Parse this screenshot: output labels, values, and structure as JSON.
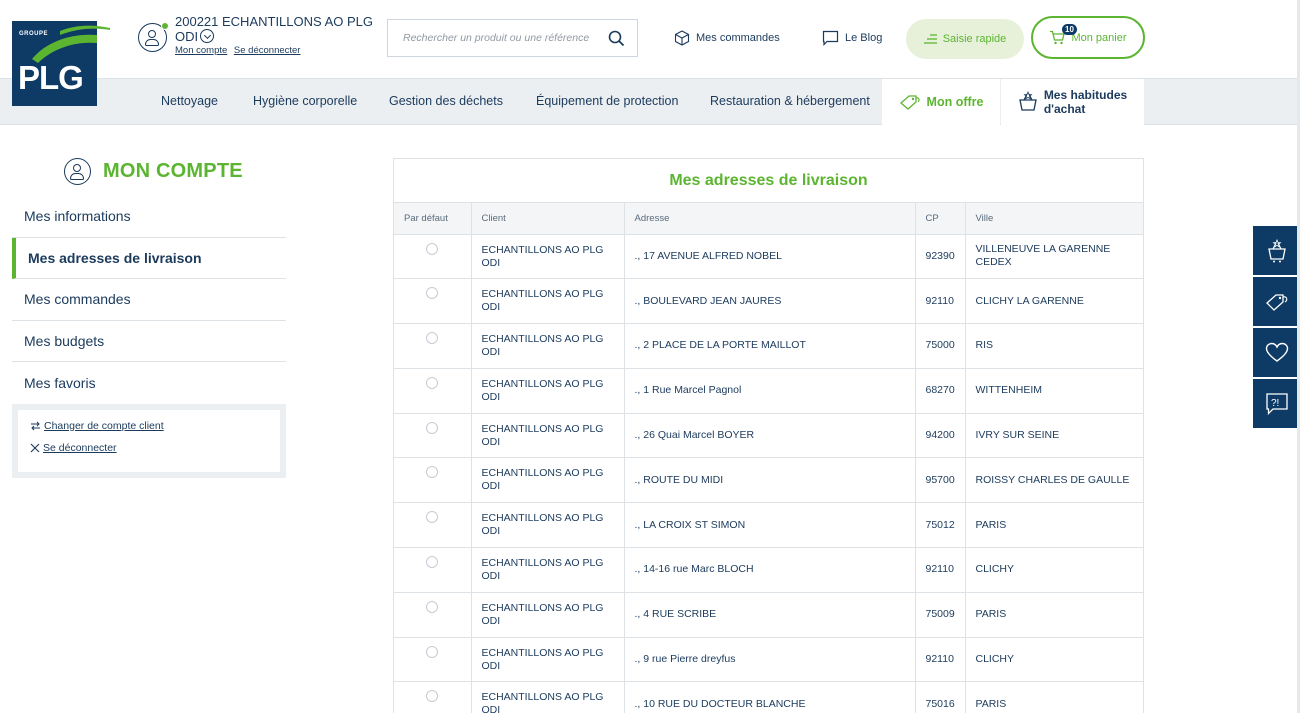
{
  "header": {
    "logo": {
      "group": "GROUPE",
      "brand": "PLG"
    },
    "account": {
      "name_line1": "200221 ECHANTILLONS AO PLG",
      "name_line2": "ODI",
      "my_account": "Mon compte",
      "logout": "Se déconnecter"
    },
    "search": {
      "placeholder": "Rechercher un produit ou une référence"
    },
    "orders_label": "Mes commandes",
    "blog_label": "Le Blog",
    "quick_entry_label": "Saisie rapide",
    "cart": {
      "label": "Mon panier",
      "count": "10"
    }
  },
  "nav": {
    "items": [
      "Nettoyage",
      "Hygiène corporelle",
      "Gestion des déchets",
      "Équipement de protection",
      "Restauration & hébergement"
    ],
    "offer": "Mon offre",
    "habits_line1": "Mes habitudes",
    "habits_line2": "d'achat"
  },
  "sidebar": {
    "title": "MON COMPTE",
    "items": [
      "Mes informations",
      "Mes adresses de livraison",
      "Mes commandes",
      "Mes budgets",
      "Mes favoris"
    ],
    "active_index": 1,
    "change_account": "Changer de compte client",
    "logout": "Se déconnecter"
  },
  "addresses": {
    "title": "Mes adresses de livraison",
    "columns": [
      "Par défaut",
      "Client",
      "Adresse",
      "CP",
      "Ville"
    ],
    "rows": [
      {
        "client": "ECHANTILLONS AO PLG ODI",
        "address": "., 17 AVENUE ALFRED NOBEL",
        "cp": "92390",
        "city": "VILLENEUVE LA GARENNE CEDEX"
      },
      {
        "client": "ECHANTILLONS AO PLG ODI",
        "address": "., BOULEVARD JEAN JAURES",
        "cp": "92110",
        "city": "CLICHY LA GARENNE"
      },
      {
        "client": "ECHANTILLONS AO PLG ODI",
        "address": "., 2 PLACE DE LA PORTE MAILLOT",
        "cp": "75000",
        "city": "RIS"
      },
      {
        "client": "ECHANTILLONS AO PLG ODI",
        "address": "., 1 Rue Marcel Pagnol",
        "cp": "68270",
        "city": "WITTENHEIM"
      },
      {
        "client": "ECHANTILLONS AO PLG ODI",
        "address": "., 26 Quai Marcel BOYER",
        "cp": "94200",
        "city": "IVRY SUR SEINE"
      },
      {
        "client": "ECHANTILLONS AO PLG ODI",
        "address": "., ROUTE DU MIDI",
        "cp": "95700",
        "city": "ROISSY CHARLES DE GAULLE"
      },
      {
        "client": "ECHANTILLONS AO PLG ODI",
        "address": "., LA CROIX ST SIMON",
        "cp": "75012",
        "city": "PARIS"
      },
      {
        "client": "ECHANTILLONS AO PLG ODI",
        "address": "., 14-16 rue Marc BLOCH",
        "cp": "92110",
        "city": "CLICHY"
      },
      {
        "client": "ECHANTILLONS AO PLG ODI",
        "address": "., 4 RUE SCRIBE",
        "cp": "75009",
        "city": "PARIS"
      },
      {
        "client": "ECHANTILLONS AO PLG ODI",
        "address": "., 9 rue Pierre dreyfus",
        "cp": "92110",
        "city": "CLICHY"
      },
      {
        "client": "ECHANTILLONS AO PLG ODI",
        "address": "., 10 RUE DU DOCTEUR BLANCHE",
        "cp": "75016",
        "city": "PARIS"
      }
    ]
  },
  "floating_bar": {
    "icons": [
      "basket-icon",
      "tag-icon",
      "heart-icon",
      "help-chat-icon"
    ]
  },
  "colors": {
    "brand_green": "#5cb531",
    "brand_navy": "#0e3a66",
    "text": "#1b3a5c"
  }
}
